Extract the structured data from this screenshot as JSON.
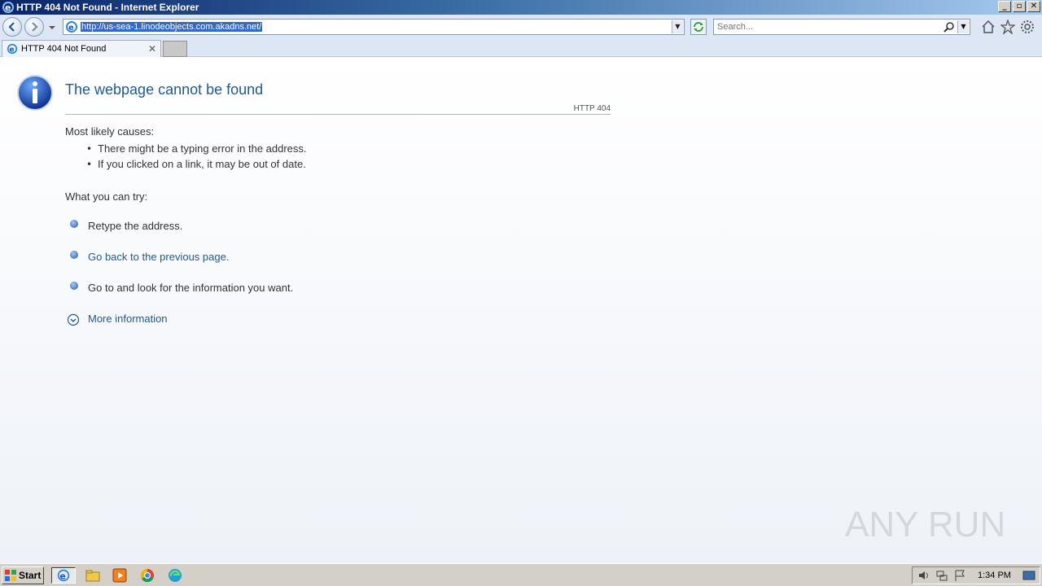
{
  "window": {
    "title": "HTTP 404 Not Found - Internet Explorer",
    "buttons": {
      "minimize": "_",
      "maximize": "▫",
      "close": "✕"
    }
  },
  "toolbar": {
    "address_url": "http://us-sea-1.linodeobjects.com.akadns.net/",
    "search_placeholder": "Search..."
  },
  "tabs": [
    {
      "label": "HTTP 404 Not Found",
      "close": "✕"
    }
  ],
  "page": {
    "heading": "The webpage cannot be found",
    "error_code": "HTTP 404",
    "causes_title": "Most likely causes:",
    "causes": [
      "There might be a typing error in the address.",
      "If you clicked on a link, it may be out of date."
    ],
    "try_title": "What you can try:",
    "try_items": [
      "Retype the address.",
      "Go back to the previous page.",
      "Go to  and look for the information you want."
    ],
    "more_info": "More information"
  },
  "watermark": "ANY RUN",
  "taskbar": {
    "start_label": "Start",
    "clock": "1:34 PM"
  }
}
